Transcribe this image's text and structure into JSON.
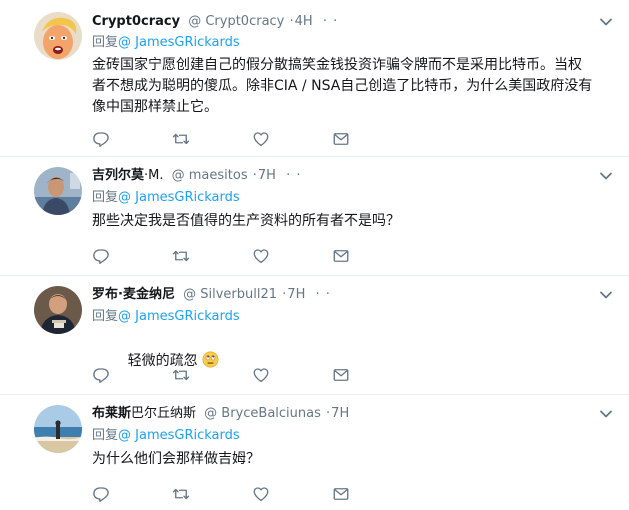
{
  "colors": {
    "accent": "#1da1f2",
    "secondary_text": "#657786",
    "primary_text": "#14171a",
    "divider": "#e6ecf0"
  },
  "reply_prefix": "回复",
  "tweets": [
    {
      "fullname": "Crypt0cracy",
      "handle": "@ Crypt0cracy",
      "sep": "·",
      "time": "4H",
      "dots": "· ·",
      "reply_mention": "@ JamesGRickards",
      "text": "金砖国家宁愿创建自己的假分散搞笑金钱投资诈骗令牌而不是采用比特币。当权\n者不想成为聪明的傻瓜。除非CIA / NSA自己创造了比特币，为什么美国政府没有\n像中国那样禁止它。",
      "avatar_icon": "trump-cartoon-avatar"
    },
    {
      "fullname": "吉列尔莫",
      "fullname_suffix": "·M.",
      "handle": "@ maesitos",
      "sep": "·",
      "time": "7H",
      "dots": "· ·",
      "reply_mention": "@ JamesGRickards",
      "text": "那些决定我是否值得的生产资料的所有者不是吗？",
      "avatar_icon": "man-photo-avatar"
    },
    {
      "fullname": "罗布",
      "fullname_suffix": "·麦金纳尼",
      "handle": "@ Silverbull21",
      "sep": "·",
      "time": "7H",
      "dots": "· ·",
      "reply_mention": "@ JamesGRickards",
      "text": "轻微的疏忽",
      "emoji_icon": "rolling-eyes-emoji-icon",
      "avatar_icon": "man-with-silver-avatar"
    },
    {
      "fullname": "布莱斯",
      "fullname_suffix": "巴尔丘纳斯",
      "handle": "@ BryceBalciunas",
      "sep": "·",
      "time": "7H",
      "dots": "",
      "reply_mention": "@ JamesGRickards",
      "text": "为什么他们会那样做吉姆？",
      "avatar_icon": "beach-person-avatar"
    }
  ],
  "action_icons": [
    "reply-icon",
    "retweet-icon",
    "like-icon",
    "message-icon"
  ]
}
